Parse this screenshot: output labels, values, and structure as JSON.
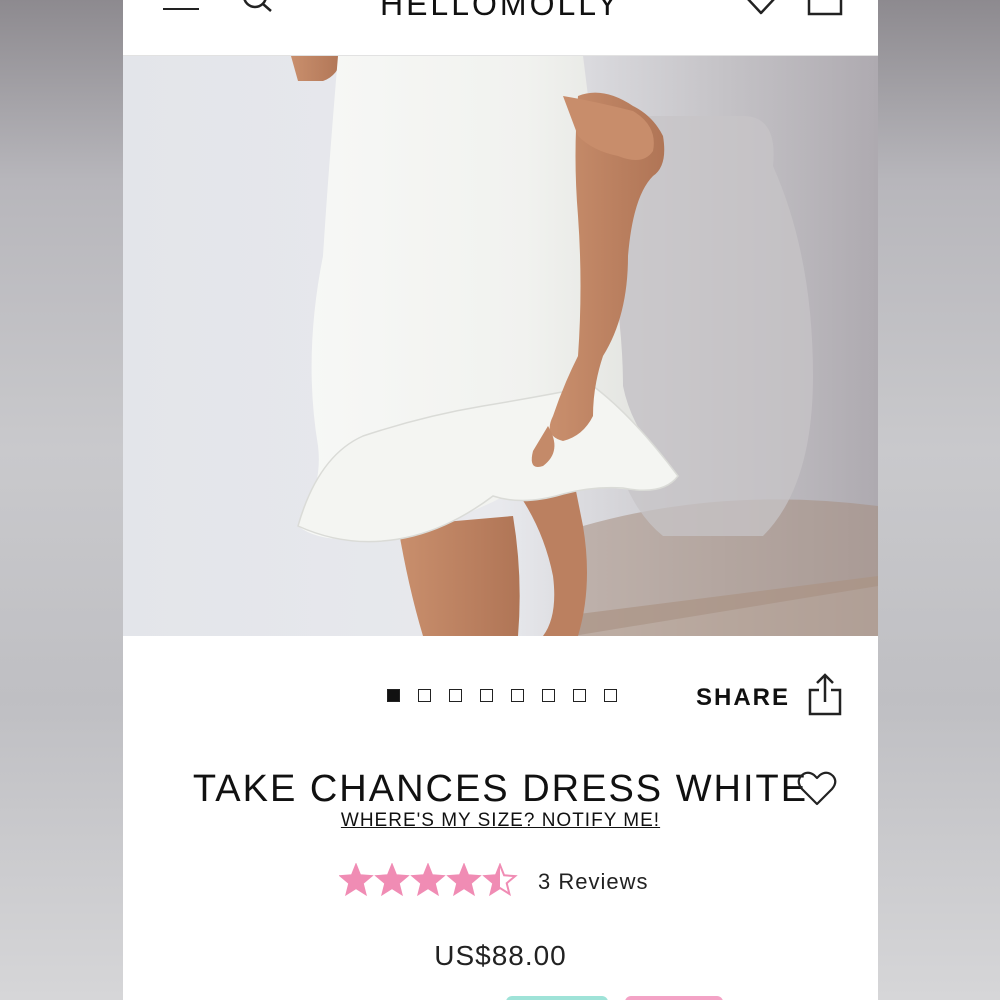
{
  "header": {
    "brand": "HELLOMOLLY",
    "menu_icon": "hamburger-menu-icon",
    "search_icon": "search-icon",
    "wishlist_icon": "heart-icon",
    "bag_icon": "shopping-bag-icon"
  },
  "gallery": {
    "image_alt": "White ruffle hem mini dress",
    "total_images": 8,
    "active_index": 0,
    "share_label": "SHARE",
    "share_icon": "share-icon"
  },
  "product": {
    "title": "TAKE CHANCES DRESS WHITE",
    "wishlist_icon": "heart-outline-icon",
    "notify_link": "WHERE'S MY SIZE? NOTIFY ME!",
    "rating": 4.5,
    "rating_max": 5,
    "reviews_label": "3 Reviews",
    "price": "US$88.00"
  },
  "colors": {
    "star": "#f08cb4",
    "text": "#111111",
    "button_mint": "#9fe3d8",
    "button_pink": "#f4a3c6"
  }
}
